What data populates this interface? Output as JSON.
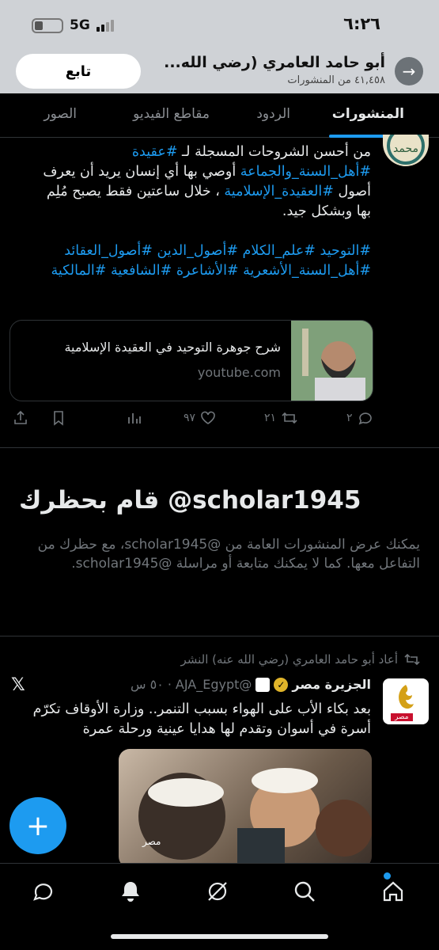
{
  "status_bar": {
    "time": "٦:٢٦",
    "network": "5G"
  },
  "header": {
    "profile_name": "أبو حامد العامري (رضي الله...",
    "posts_count": "٤١,٤٥٨ من المنشورات",
    "follow_label": "تابع",
    "back_icon": "arrow-right-icon"
  },
  "tabs": [
    {
      "label": "المنشورات",
      "active": true
    },
    {
      "label": "الردود",
      "active": false
    },
    {
      "label": "مقاطع الفيديو",
      "active": false
    },
    {
      "label": "الصور",
      "active": false
    }
  ],
  "tweet1": {
    "line1_plain": "من أحسن الشروحات المسجلة لـ ",
    "line1_tag": "#عقيدة",
    "line2_tag": "#أهل_السنة_والجماعة",
    "line2_plain": " أوصي بها أي إنسان يريد أن يعرف",
    "line3_plain_a": "أصول ",
    "line3_tag": "#العقيدة_الإسلامية",
    "line3_plain_b": " ، خلال ساعتين فقط يصبح مُلِم",
    "line4_plain": "بها وبشكل جيد.",
    "hashtags_line1": "#التوحيد #علم_الكلام #أصول_الدين #أصول_العقائد",
    "hashtags_line2": "#أهل_السنة_الأشعرية #الأشاعرة #الشافعية #المالكية",
    "card_title": "شرح جوهرة التوحيد في العقيدة الإسلامية",
    "card_domain": "youtube.com",
    "replies": "٢",
    "retweets": "٢١",
    "likes": "٩٧"
  },
  "blocked": {
    "title": "قام بحظرك @scholar1945",
    "body": "يمكنك عرض المنشورات العامة من @scholar1945، مع حظرك من التفاعل معها. كما لا يمكنك متابعة أو مراسلة @scholar1945."
  },
  "tweet2": {
    "retweet_note": "أعاد أبو حامد العامري (رضي الله عنه) النشر",
    "author_name": "الجزيرة مصر",
    "handle": "@AJA_Egypt",
    "time": "٥٠ س",
    "text_line1": "بعد بكاء الأب على الهواء بسبب التنمر.. وزارة الأوقاف تكرّم",
    "text_line2": "أسرة في أسوان وتقدم لها هدايا عينية ورحلة عمرة",
    "avatar_label": "مصر",
    "media_label": "مصر"
  },
  "fab_label": "+",
  "colors": {
    "accent": "#1d9bf0",
    "background": "#000000",
    "muted": "#71767b"
  }
}
